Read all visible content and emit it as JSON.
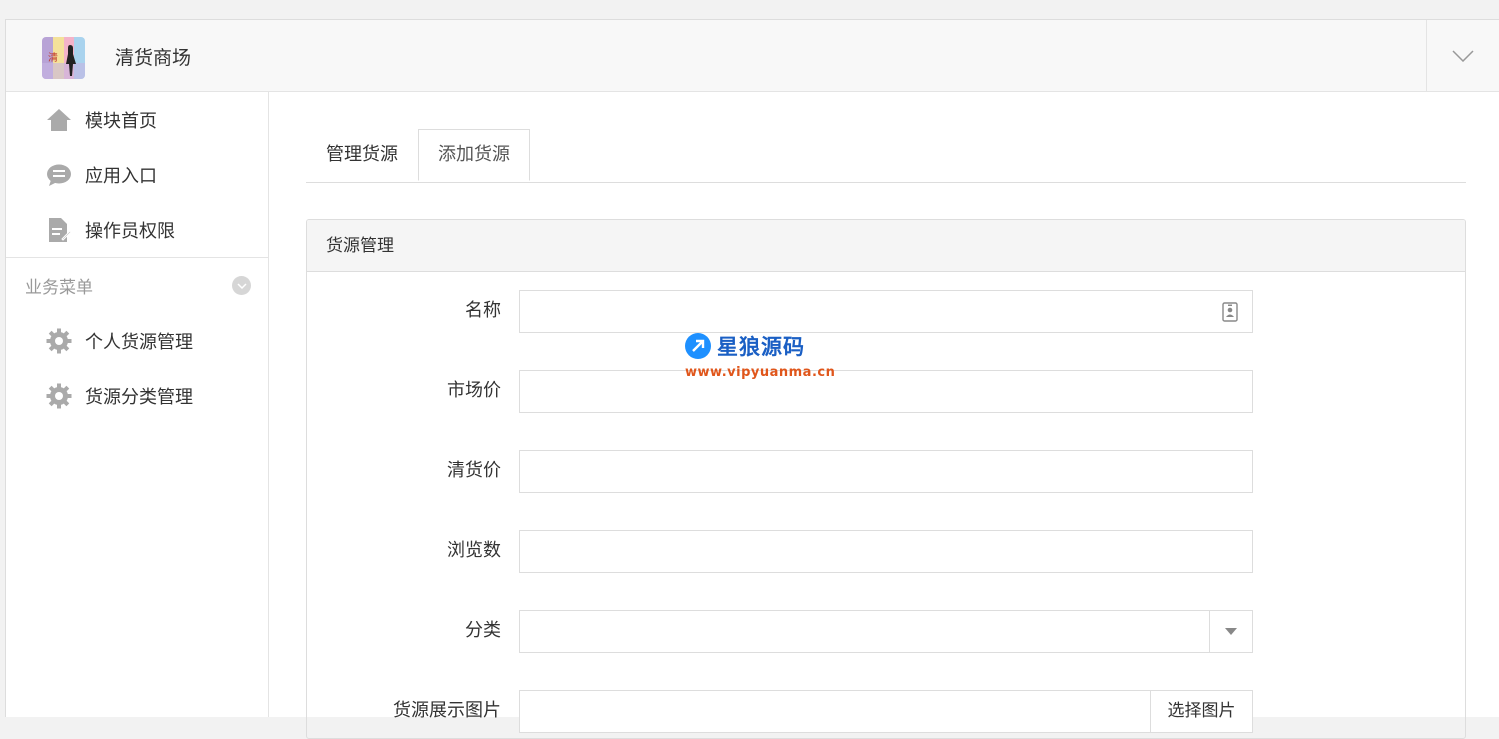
{
  "header": {
    "app_title": "清货商场",
    "logo_name": "store-logo"
  },
  "sidebar": {
    "items": [
      {
        "label": "模块首页",
        "icon": "home-icon"
      },
      {
        "label": "应用入口",
        "icon": "chat-bubble-icon"
      },
      {
        "label": "操作员权限",
        "icon": "document-edit-icon"
      }
    ],
    "section_title": "业务菜单",
    "section_items": [
      {
        "label": "个人货源管理",
        "icon": "gear-icon"
      },
      {
        "label": "货源分类管理",
        "icon": "gear-icon"
      }
    ]
  },
  "tabs": [
    {
      "label": "管理货源",
      "active": false
    },
    {
      "label": "添加货源",
      "active": true
    }
  ],
  "panel": {
    "title": "货源管理",
    "fields": {
      "name": {
        "label": "名称",
        "value": ""
      },
      "market_price": {
        "label": "市场价",
        "value": ""
      },
      "clearance_price": {
        "label": "清货价",
        "value": ""
      },
      "views": {
        "label": "浏览数",
        "value": ""
      },
      "category": {
        "label": "分类",
        "value": ""
      },
      "image": {
        "label": "货源展示图片",
        "value": "",
        "button": "选择图片"
      }
    }
  },
  "watermark": {
    "title": "星狼源码",
    "url": "www.vipyuanma.cn"
  },
  "colors": {
    "accent_blue": "#1e90ff",
    "watermark_orange": "#e0561b",
    "icon_gray": "#aaaaaa"
  }
}
